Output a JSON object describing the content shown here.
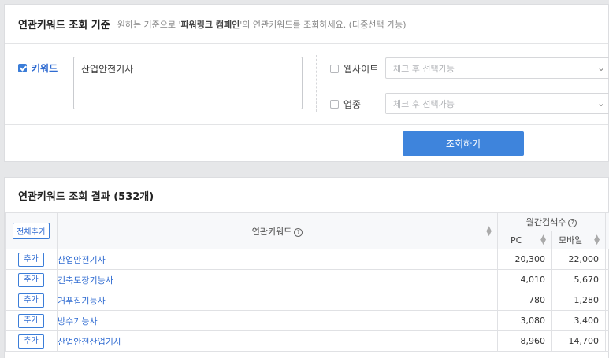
{
  "criteria": {
    "title": "연관키워드 조회 기준",
    "desc_pre": "원하는 기준으로 '",
    "desc_bold": "파워링크 캠페인",
    "desc_post": "'의 연관키워드를 조회하세요. (다중선택 가능)",
    "keyword_label": "키워드",
    "keyword_checked": true,
    "keyword_value": "산업안전기사",
    "website_label": "웹사이트",
    "website_placeholder": "체크 후 선택가능",
    "industry_label": "업종",
    "industry_placeholder": "체크 후 선택가능",
    "search_button": "조회하기"
  },
  "results": {
    "title": "연관키워드 조회 결과 (532개)",
    "add_all_label": "전체추가",
    "col_keyword": "연관키워드",
    "col_monthly": "월간검색수",
    "col_pc": "PC",
    "col_mobile": "모바일",
    "add_label": "추가",
    "rows": [
      {
        "keyword": "산업안전기사",
        "pc": "20,300",
        "mobile": "22,000"
      },
      {
        "keyword": "건축도장기능사",
        "pc": "4,010",
        "mobile": "5,670"
      },
      {
        "keyword": "거푸집기능사",
        "pc": "780",
        "mobile": "1,280"
      },
      {
        "keyword": "방수기능사",
        "pc": "3,080",
        "mobile": "3,400"
      },
      {
        "keyword": "산업안전산업기사",
        "pc": "8,960",
        "mobile": "14,700"
      }
    ]
  }
}
